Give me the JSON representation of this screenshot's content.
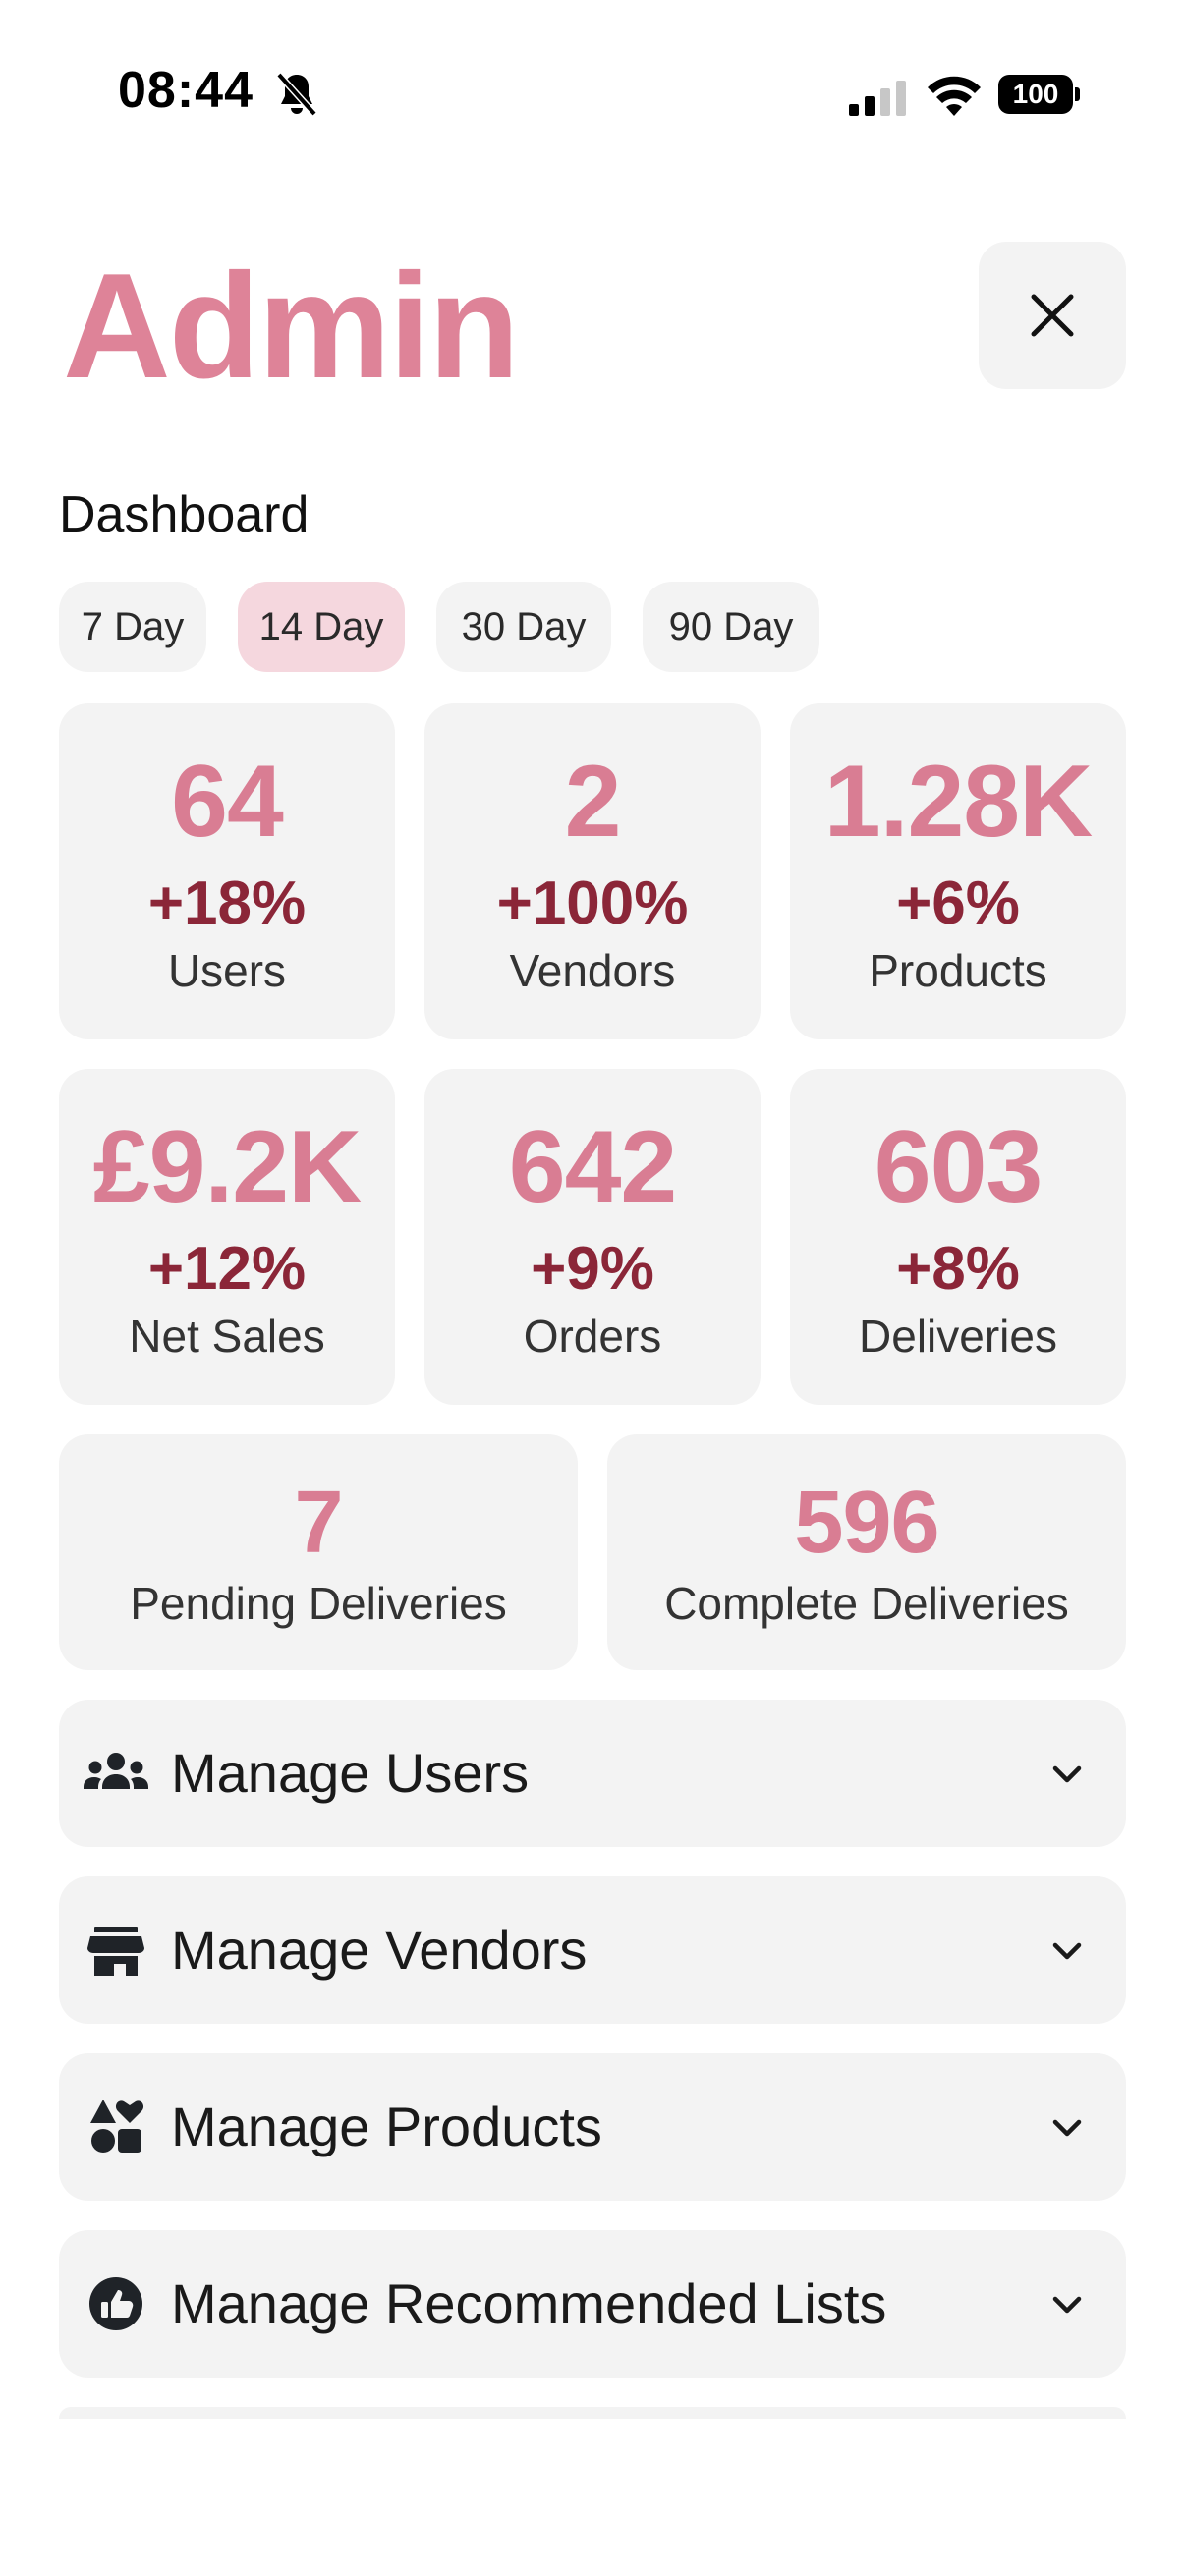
{
  "status_bar": {
    "time": "08:44",
    "battery": "100",
    "icons": [
      "bell-off-icon",
      "signal-icon",
      "wifi-icon",
      "battery-icon"
    ]
  },
  "header": {
    "title": "Admin",
    "close_icon": "close-icon"
  },
  "dashboard": {
    "heading": "Dashboard",
    "ranges": [
      {
        "label": "7 Day",
        "active": false
      },
      {
        "label": "14 Day",
        "active": true
      },
      {
        "label": "30 Day",
        "active": false
      },
      {
        "label": "90 Day",
        "active": false
      }
    ],
    "stats": [
      {
        "value": "64",
        "change": "+18%",
        "label": "Users"
      },
      {
        "value": "2",
        "change": "+100%",
        "label": "Vendors"
      },
      {
        "value": "1.28K",
        "change": "+6%",
        "label": "Products"
      },
      {
        "value": "£9.2K",
        "change": "+12%",
        "label": "Net Sales"
      },
      {
        "value": "642",
        "change": "+9%",
        "label": "Orders"
      },
      {
        "value": "603",
        "change": "+8%",
        "label": "Deliveries"
      }
    ],
    "delivery_stats": [
      {
        "value": "7",
        "label": "Pending Deliveries"
      },
      {
        "value": "596",
        "label": "Complete Deliveries"
      }
    ]
  },
  "sections": [
    {
      "label": "Manage Users",
      "icon": "users-group-icon"
    },
    {
      "label": "Manage Vendors",
      "icon": "store-icon"
    },
    {
      "label": "Manage Products",
      "icon": "shapes-icon"
    },
    {
      "label": "Manage Recommended Lists",
      "icon": "thumbs-up-icon"
    }
  ],
  "colors": {
    "accent": "#de8398",
    "change": "#8b2638",
    "card_bg": "#f3f3f3",
    "active_pill": "#f5d7de"
  }
}
